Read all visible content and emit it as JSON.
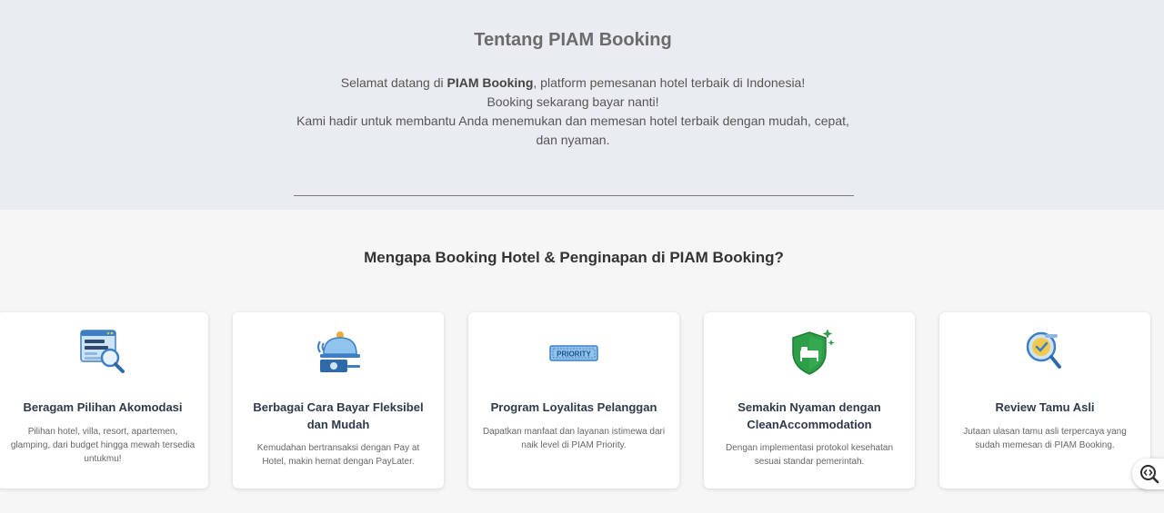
{
  "about": {
    "title": "Tentang PIAM Booking",
    "line1_prefix": "Selamat datang di ",
    "line1_brand": "PIAM Booking",
    "line1_suffix": ", platform pemesanan hotel terbaik di Indonesia!",
    "line2": "Booking sekarang bayar nanti!",
    "line3": "Kami hadir untuk membantu Anda menemukan dan memesan hotel terbaik dengan mudah, cepat, dan nyaman."
  },
  "why": {
    "title": "Mengapa Booking Hotel & Penginapan di PIAM Booking?",
    "cards": [
      {
        "icon": "accommodation-search-icon",
        "title": "Beragam Pilihan Akomodasi",
        "description": "Pilihan hotel, villa, resort, apartemen, glamping, dari budget hingga mewah tersedia untukmu!"
      },
      {
        "icon": "payment-bell-icon",
        "title": "Berbagai Cara Bayar Fleksibel dan Mudah",
        "description": "Kemudahan bertransaksi dengan Pay at Hotel, makin hemat dengan PayLater."
      },
      {
        "icon": "priority-ticket-icon",
        "icon_text": "PRIORITY",
        "title": "Program Loyalitas Pelanggan",
        "description": "Dapatkan manfaat dan layanan istimewa dari naik level di PIAM Priority."
      },
      {
        "icon": "clean-shield-bed-icon",
        "title": "Semakin Nyaman dengan CleanAccommodation",
        "description": "Dengan implementasi protokol kesehatan sesuai standar pemerintah."
      },
      {
        "icon": "verified-review-icon",
        "title": "Review Tamu Asli",
        "description": "Jutaan ulasan tamu asli terpercaya yang sudah memesan di PIAM Booking."
      }
    ]
  },
  "floating_button": {
    "icon": "code-search-icon"
  },
  "colors": {
    "about_bg": "#e9edf1",
    "page_bg": "#f6f6f6",
    "card_bg": "#ffffff",
    "accent_blue": "#3e8ed8",
    "accent_green": "#2e9e48"
  }
}
